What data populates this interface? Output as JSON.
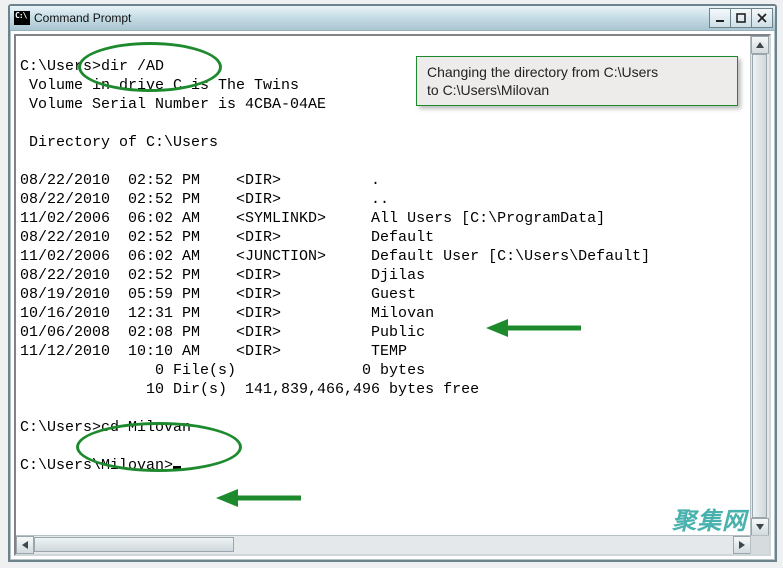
{
  "window": {
    "title": "Command Prompt"
  },
  "callout": {
    "line1": "Changing the directory from C:\\Users",
    "line2": "to C:\\Users\\Milovan"
  },
  "term": {
    "l01": "",
    "l02": "C:\\Users>dir /AD",
    "l03": " Volume in drive C is The Twins",
    "l04": " Volume Serial Number is 4CBA-04AE",
    "l05": "",
    "l06": " Directory of C:\\Users",
    "l07": "",
    "l08": "08/22/2010  02:52 PM    <DIR>          .",
    "l09": "08/22/2010  02:52 PM    <DIR>          ..",
    "l10": "11/02/2006  06:02 AM    <SYMLINKD>     All Users [C:\\ProgramData]",
    "l11": "08/22/2010  02:52 PM    <DIR>          Default",
    "l12": "11/02/2006  06:02 AM    <JUNCTION>     Default User [C:\\Users\\Default]",
    "l13": "08/22/2010  02:52 PM    <DIR>          Djilas",
    "l14": "08/19/2010  05:59 PM    <DIR>          Guest",
    "l15": "10/16/2010  12:31 PM    <DIR>          Milovan",
    "l16": "01/06/2008  02:08 PM    <DIR>          Public",
    "l17": "11/12/2010  10:10 AM    <DIR>          TEMP",
    "l18": "               0 File(s)              0 bytes",
    "l19": "              10 Dir(s)  141,839,466,496 bytes free",
    "l20": "",
    "l21": "C:\\Users>cd Milovan",
    "l22": "",
    "l23": "C:\\Users\\Milovan>"
  },
  "watermark": "聚集网"
}
